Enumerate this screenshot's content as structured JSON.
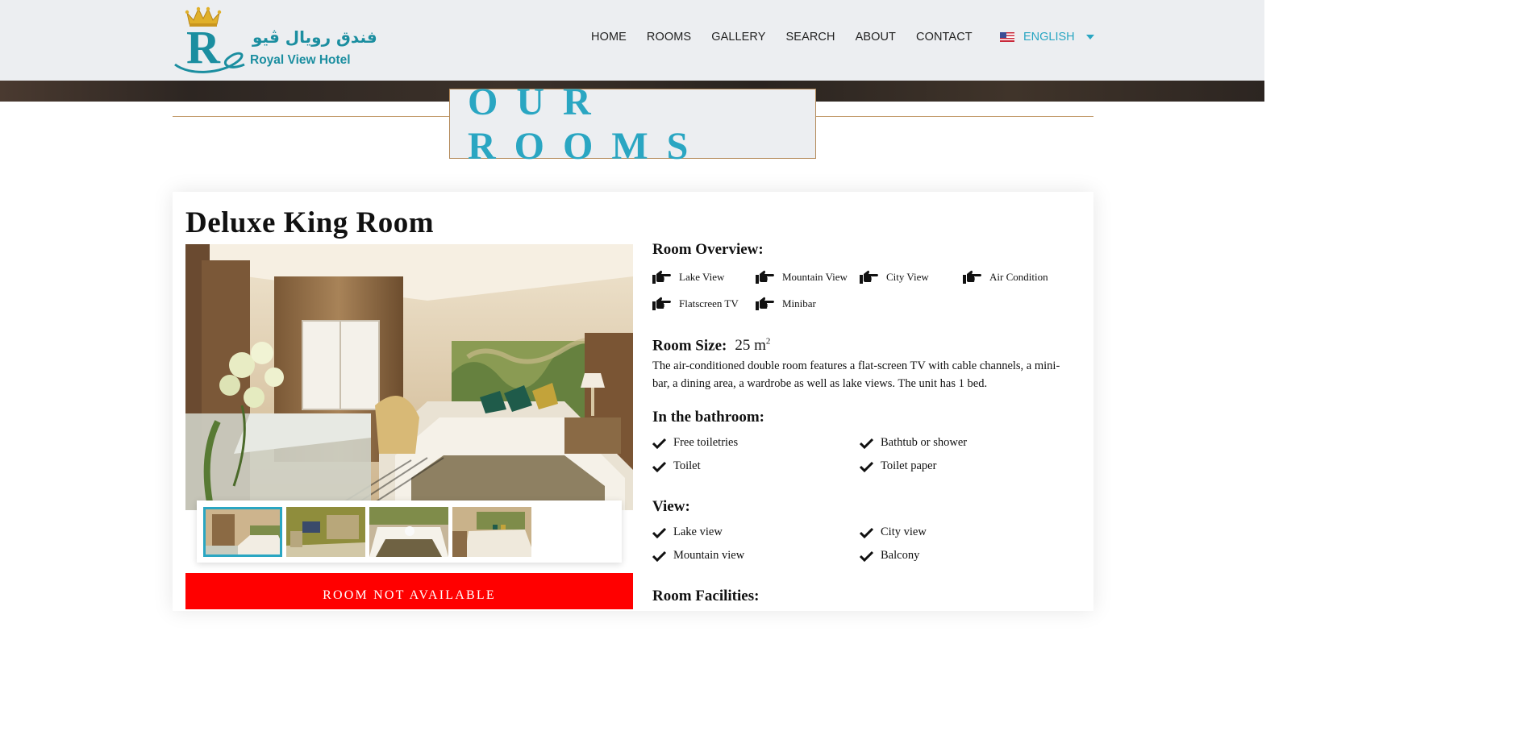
{
  "header": {
    "brand_name": "Royal View Hotel",
    "brand_arabic": "فندق رويال ڤيو",
    "nav": [
      "HOME",
      "ROOMS",
      "GALLERY",
      "SEARCH",
      "ABOUT",
      "CONTACT"
    ],
    "language": "ENGLISH"
  },
  "page": {
    "heading": "OUR ROOMS"
  },
  "room": {
    "title": "Deluxe King Room",
    "status": "ROOM NOT AVAILABLE",
    "overview_title": "Room Overview:",
    "overview": [
      "Lake View",
      "Mountain View",
      "City View",
      "Air Condition",
      "Flatscreen TV",
      "Minibar"
    ],
    "size_label": "Room Size:",
    "size_value": "25 m",
    "size_unit_sup": "2",
    "description": "The air-conditioned double room features a flat-screen TV with cable channels, a mini-bar, a dining area, a wardrobe as well as lake views. The unit has 1 bed.",
    "bathroom_title": "In the bathroom:",
    "bathroom": [
      "Free toiletries",
      "Bathtub or shower",
      "Toilet",
      "Toilet paper"
    ],
    "view_title": "View:",
    "view": [
      "Lake view",
      "City view",
      "Mountain view",
      "Balcony"
    ],
    "facilities_title": "Room Facilities:"
  },
  "colors": {
    "accent": "#2aa6c2",
    "brand": "#1b8ea0",
    "status": "#ff0000",
    "gold": "#c29a6a"
  },
  "icons": {
    "overview_item": "hand-point-right-icon",
    "list_item": "check-icon",
    "language_flag": "us-flag-icon",
    "language_caret": "caret-down-icon"
  }
}
